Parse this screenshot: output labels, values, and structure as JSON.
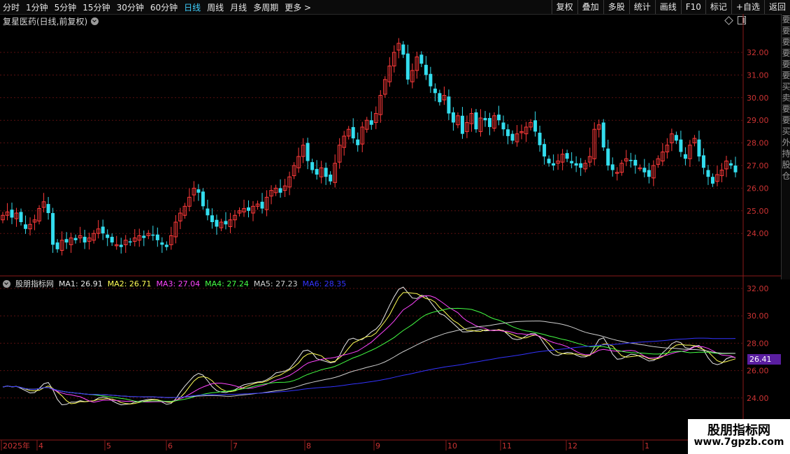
{
  "toolbar": {
    "periods": [
      "分时",
      "1分钟",
      "5分钟",
      "15分钟",
      "30分钟",
      "60分钟",
      "日线",
      "周线",
      "月线",
      "多周期",
      "更多 >"
    ],
    "active_period": "日线",
    "buttons": [
      "复权",
      "叠加",
      "多股",
      "统计",
      "画线",
      "F10",
      "标记",
      "+自选",
      "返回"
    ]
  },
  "stock": {
    "title": "复星医药(日线,前复权)"
  },
  "indicator": {
    "name": "股朋指标网",
    "items": [
      {
        "label": "MA1: 26.91",
        "color": "#e8e8e8"
      },
      {
        "label": "MA2: 26.71",
        "color": "#ffff55"
      },
      {
        "label": "MA3: 27.04",
        "color": "#ff44ff"
      },
      {
        "label": "MA4: 27.24",
        "color": "#44ff44"
      },
      {
        "label": "MA5: 27.23",
        "color": "#cfcfcf"
      },
      {
        "label": "MA6: 28.35",
        "color": "#3333ff"
      }
    ],
    "current_value": "26.41"
  },
  "price_axis": [
    "32.00",
    "31.00",
    "30.00",
    "29.00",
    "28.00",
    "27.00",
    "26.00",
    "25.00",
    "24.00"
  ],
  "indicator_axis": [
    "32.00",
    "30.00",
    "28.00",
    "26.00",
    "24.00"
  ],
  "time_axis": [
    "2025年",
    "4",
    "5",
    "6",
    "7",
    "8",
    "9",
    "10",
    "11",
    "12",
    "1"
  ],
  "right_strip": "要要要要要要买卖要要买外持股仓",
  "watermark": {
    "line1": "股朋指标网",
    "line2": "www.7gpzb.com"
  },
  "colors": {
    "up": "#ff3a3a",
    "down": "#33ddee",
    "grid": "#7a1a1a",
    "axis_text": "#cc3333"
  },
  "chart_data": {
    "type": "candlestick",
    "series_close": [
      24.8,
      24.95,
      24.7,
      24.9,
      24.5,
      24.2,
      24.4,
      24.6,
      25.1,
      25.4,
      24.9,
      23.5,
      23.3,
      23.7,
      23.6,
      23.8,
      23.7,
      23.9,
      23.6,
      23.8,
      24.0,
      24.2,
      24.0,
      23.8,
      23.6,
      23.5,
      23.4,
      23.7,
      23.6,
      23.8,
      23.9,
      23.8,
      24.0,
      23.9,
      23.7,
      23.5,
      23.4,
      23.9,
      24.5,
      24.9,
      25.2,
      25.6,
      26.0,
      25.8,
      25.2,
      24.8,
      24.5,
      24.3,
      24.5,
      24.4,
      24.6,
      24.8,
      25.0,
      25.1,
      25.0,
      25.2,
      25.3,
      25.1,
      25.6,
      25.9,
      26.0,
      25.8,
      26.1,
      26.5,
      27.0,
      27.4,
      27.9,
      27.2,
      26.8,
      26.6,
      26.9,
      26.5,
      26.3,
      27.1,
      27.9,
      28.3,
      28.6,
      28.2,
      27.9,
      28.7,
      29.0,
      28.8,
      29.3,
      30.1,
      30.8,
      31.4,
      32.0,
      32.4,
      31.9,
      30.8,
      31.2,
      31.8,
      31.5,
      31.0,
      30.5,
      30.2,
      29.8,
      30.1,
      29.3,
      28.9,
      29.2,
      28.4,
      28.9,
      29.3,
      28.6,
      29.1,
      29.0,
      28.7,
      29.2,
      29.0,
      28.6,
      28.3,
      28.1,
      28.4,
      28.5,
      28.7,
      28.9,
      28.5,
      27.9,
      27.4,
      27.1,
      27.0,
      27.2,
      27.5,
      27.3,
      27.1,
      27.0,
      26.9,
      27.1,
      27.4,
      28.6,
      28.8,
      27.8,
      27.0,
      26.8,
      26.7,
      27.1,
      27.3,
      27.2,
      27.0,
      26.9,
      26.7,
      26.5,
      27.0,
      27.3,
      27.6,
      27.9,
      28.4,
      28.1,
      27.6,
      27.3,
      27.9,
      28.2,
      27.4,
      26.9,
      26.5,
      26.2,
      26.6,
      26.8,
      27.2,
      27.0,
      26.7
    ]
  }
}
